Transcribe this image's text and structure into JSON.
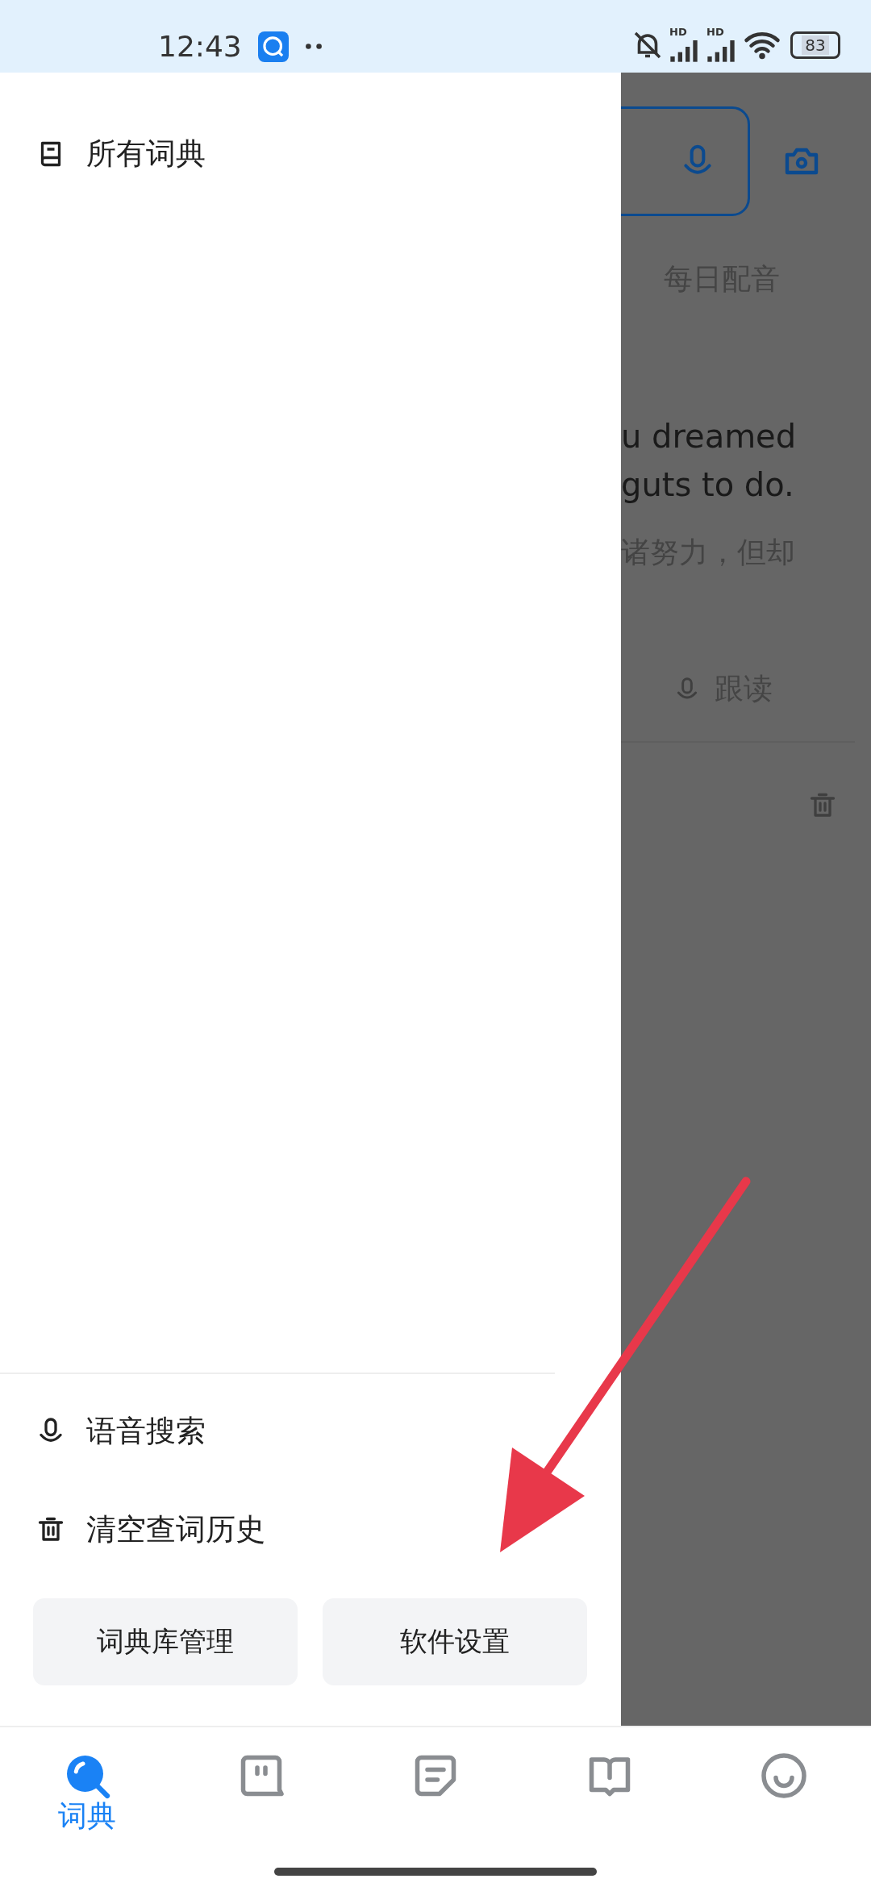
{
  "status_bar": {
    "time": "12:43",
    "signals": [
      "HD",
      "HD"
    ],
    "battery": "83"
  },
  "background": {
    "daily_tab": "每日配音",
    "quote_lines": [
      "u dreamed",
      "guts to do."
    ],
    "translation": "诸努力，但却",
    "follow_read": "跟读"
  },
  "drawer": {
    "items": [
      {
        "label": "所有词典",
        "kind": "dictionary"
      }
    ],
    "actions": [
      {
        "label": "语音搜索",
        "kind": "voice"
      },
      {
        "label": "清空查词历史",
        "kind": "trash"
      }
    ],
    "buttons": [
      "词典库管理",
      "软件设置"
    ]
  },
  "bottom_nav": [
    {
      "label": "词典",
      "kind": "search",
      "selected": true
    },
    {
      "kind": "chat",
      "selected": false
    },
    {
      "kind": "notes",
      "selected": false
    },
    {
      "kind": "reading",
      "selected": false
    },
    {
      "kind": "profile",
      "selected": false
    }
  ]
}
